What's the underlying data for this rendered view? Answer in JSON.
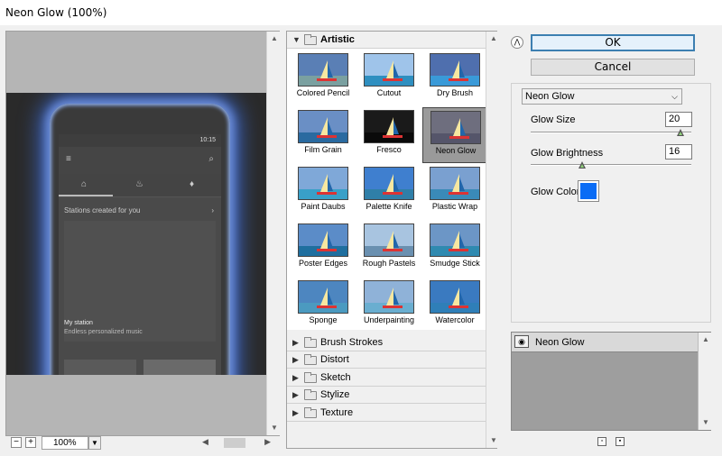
{
  "window": {
    "title": "Neon Glow (100%)"
  },
  "preview": {
    "zoom": "100%",
    "zoom_out_label": "−",
    "zoom_in_label": "+",
    "phone": {
      "clock": "10:15",
      "section_title": "Stations created for you",
      "section_arrow": "›",
      "station_title": "My station",
      "station_subtitle": "Endless personalized music"
    }
  },
  "gallery": {
    "categories": [
      {
        "name": "Artistic",
        "expanded": true,
        "filters": [
          "Colored Pencil",
          "Cutout",
          "Dry Brush",
          "Film Grain",
          "Fresco",
          "Neon Glow",
          "Paint Daubs",
          "Palette Knife",
          "Plastic Wrap",
          "Poster Edges",
          "Rough Pastels",
          "Smudge Stick",
          "Sponge",
          "Underpainting",
          "Watercolor"
        ],
        "selected": "Neon Glow"
      },
      {
        "name": "Brush Strokes",
        "expanded": false
      },
      {
        "name": "Distort",
        "expanded": false
      },
      {
        "name": "Sketch",
        "expanded": false
      },
      {
        "name": "Stylize",
        "expanded": false
      },
      {
        "name": "Texture",
        "expanded": false
      }
    ]
  },
  "options": {
    "ok_label": "OK",
    "cancel_label": "Cancel",
    "filter_select": "Neon Glow",
    "glow_size_label": "Glow Size",
    "glow_size_value": "20",
    "glow_size_fraction": 0.93,
    "glow_brightness_label": "Glow Brightness",
    "glow_brightness_value": "16",
    "glow_brightness_fraction": 0.32,
    "glow_color_label": "Glow Color",
    "glow_color": "#0a6cf5"
  },
  "layers": {
    "items": [
      {
        "name": "Neon Glow",
        "visible": true
      }
    ]
  },
  "icons": {
    "collapse": "double-chevron-up-icon",
    "eye": "eye-icon",
    "new_layer": "new-effect-layer-icon",
    "delete_layer": "trash-icon"
  }
}
